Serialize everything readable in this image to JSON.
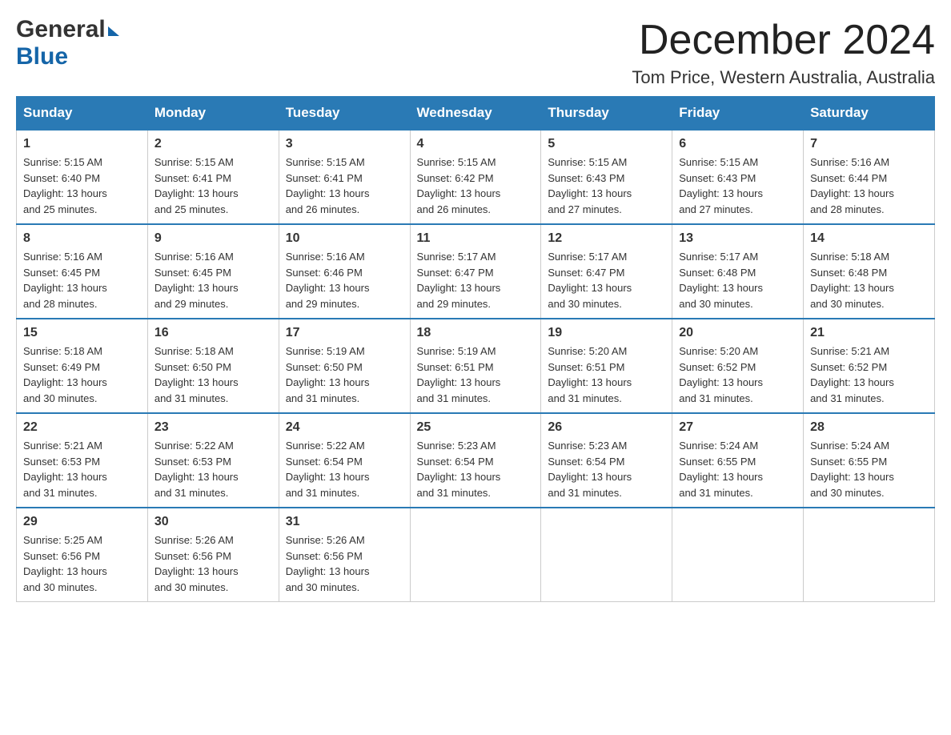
{
  "header": {
    "logo_general": "General",
    "logo_blue": "Blue",
    "month_title": "December 2024",
    "location": "Tom Price, Western Australia, Australia"
  },
  "weekdays": [
    "Sunday",
    "Monday",
    "Tuesday",
    "Wednesday",
    "Thursday",
    "Friday",
    "Saturday"
  ],
  "weeks": [
    [
      {
        "day": "1",
        "sunrise": "5:15 AM",
        "sunset": "6:40 PM",
        "daylight": "13 hours and 25 minutes."
      },
      {
        "day": "2",
        "sunrise": "5:15 AM",
        "sunset": "6:41 PM",
        "daylight": "13 hours and 25 minutes."
      },
      {
        "day": "3",
        "sunrise": "5:15 AM",
        "sunset": "6:41 PM",
        "daylight": "13 hours and 26 minutes."
      },
      {
        "day": "4",
        "sunrise": "5:15 AM",
        "sunset": "6:42 PM",
        "daylight": "13 hours and 26 minutes."
      },
      {
        "day": "5",
        "sunrise": "5:15 AM",
        "sunset": "6:43 PM",
        "daylight": "13 hours and 27 minutes."
      },
      {
        "day": "6",
        "sunrise": "5:15 AM",
        "sunset": "6:43 PM",
        "daylight": "13 hours and 27 minutes."
      },
      {
        "day": "7",
        "sunrise": "5:16 AM",
        "sunset": "6:44 PM",
        "daylight": "13 hours and 28 minutes."
      }
    ],
    [
      {
        "day": "8",
        "sunrise": "5:16 AM",
        "sunset": "6:45 PM",
        "daylight": "13 hours and 28 minutes."
      },
      {
        "day": "9",
        "sunrise": "5:16 AM",
        "sunset": "6:45 PM",
        "daylight": "13 hours and 29 minutes."
      },
      {
        "day": "10",
        "sunrise": "5:16 AM",
        "sunset": "6:46 PM",
        "daylight": "13 hours and 29 minutes."
      },
      {
        "day": "11",
        "sunrise": "5:17 AM",
        "sunset": "6:47 PM",
        "daylight": "13 hours and 29 minutes."
      },
      {
        "day": "12",
        "sunrise": "5:17 AM",
        "sunset": "6:47 PM",
        "daylight": "13 hours and 30 minutes."
      },
      {
        "day": "13",
        "sunrise": "5:17 AM",
        "sunset": "6:48 PM",
        "daylight": "13 hours and 30 minutes."
      },
      {
        "day": "14",
        "sunrise": "5:18 AM",
        "sunset": "6:48 PM",
        "daylight": "13 hours and 30 minutes."
      }
    ],
    [
      {
        "day": "15",
        "sunrise": "5:18 AM",
        "sunset": "6:49 PM",
        "daylight": "13 hours and 30 minutes."
      },
      {
        "day": "16",
        "sunrise": "5:18 AM",
        "sunset": "6:50 PM",
        "daylight": "13 hours and 31 minutes."
      },
      {
        "day": "17",
        "sunrise": "5:19 AM",
        "sunset": "6:50 PM",
        "daylight": "13 hours and 31 minutes."
      },
      {
        "day": "18",
        "sunrise": "5:19 AM",
        "sunset": "6:51 PM",
        "daylight": "13 hours and 31 minutes."
      },
      {
        "day": "19",
        "sunrise": "5:20 AM",
        "sunset": "6:51 PM",
        "daylight": "13 hours and 31 minutes."
      },
      {
        "day": "20",
        "sunrise": "5:20 AM",
        "sunset": "6:52 PM",
        "daylight": "13 hours and 31 minutes."
      },
      {
        "day": "21",
        "sunrise": "5:21 AM",
        "sunset": "6:52 PM",
        "daylight": "13 hours and 31 minutes."
      }
    ],
    [
      {
        "day": "22",
        "sunrise": "5:21 AM",
        "sunset": "6:53 PM",
        "daylight": "13 hours and 31 minutes."
      },
      {
        "day": "23",
        "sunrise": "5:22 AM",
        "sunset": "6:53 PM",
        "daylight": "13 hours and 31 minutes."
      },
      {
        "day": "24",
        "sunrise": "5:22 AM",
        "sunset": "6:54 PM",
        "daylight": "13 hours and 31 minutes."
      },
      {
        "day": "25",
        "sunrise": "5:23 AM",
        "sunset": "6:54 PM",
        "daylight": "13 hours and 31 minutes."
      },
      {
        "day": "26",
        "sunrise": "5:23 AM",
        "sunset": "6:54 PM",
        "daylight": "13 hours and 31 minutes."
      },
      {
        "day": "27",
        "sunrise": "5:24 AM",
        "sunset": "6:55 PM",
        "daylight": "13 hours and 31 minutes."
      },
      {
        "day": "28",
        "sunrise": "5:24 AM",
        "sunset": "6:55 PM",
        "daylight": "13 hours and 30 minutes."
      }
    ],
    [
      {
        "day": "29",
        "sunrise": "5:25 AM",
        "sunset": "6:56 PM",
        "daylight": "13 hours and 30 minutes."
      },
      {
        "day": "30",
        "sunrise": "5:26 AM",
        "sunset": "6:56 PM",
        "daylight": "13 hours and 30 minutes."
      },
      {
        "day": "31",
        "sunrise": "5:26 AM",
        "sunset": "6:56 PM",
        "daylight": "13 hours and 30 minutes."
      },
      null,
      null,
      null,
      null
    ]
  ],
  "labels": {
    "sunrise": "Sunrise:",
    "sunset": "Sunset:",
    "daylight": "Daylight:"
  }
}
